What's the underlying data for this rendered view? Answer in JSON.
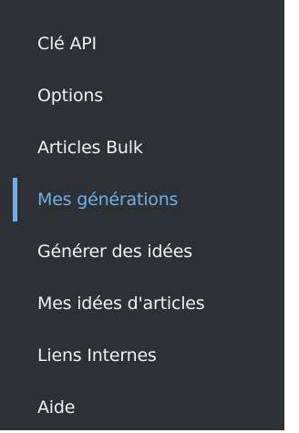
{
  "submenu": {
    "items": [
      {
        "label": "Clé API",
        "active": false
      },
      {
        "label": "Options",
        "active": false
      },
      {
        "label": "Articles Bulk",
        "active": false
      },
      {
        "label": "Mes générations",
        "active": true
      },
      {
        "label": "Générer des idées",
        "active": false
      },
      {
        "label": "Mes idées d'articles",
        "active": false
      },
      {
        "label": "Liens Internes",
        "active": false
      },
      {
        "label": "Aide",
        "active": false
      }
    ]
  },
  "colors": {
    "background": "#2d3035",
    "text": "#f0f0f1",
    "active": "#72aee6"
  }
}
